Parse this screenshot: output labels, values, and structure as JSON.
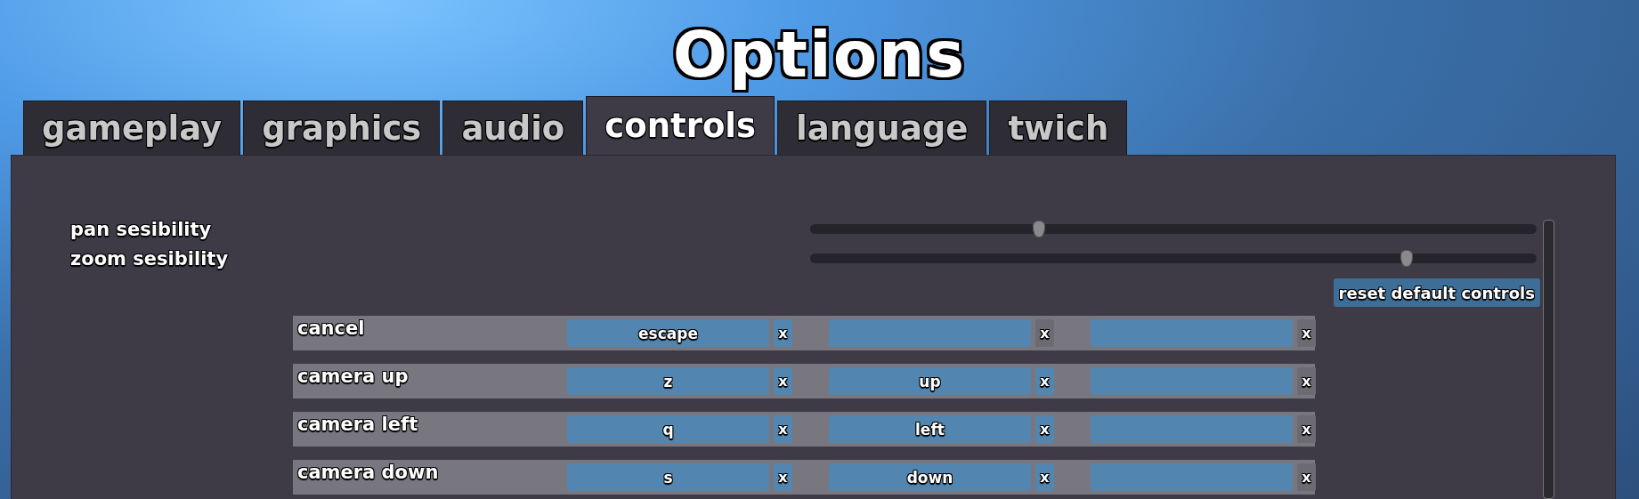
{
  "title": "Options",
  "tabs": [
    {
      "label": "gameplay",
      "selected": false
    },
    {
      "label": "graphics",
      "selected": false
    },
    {
      "label": "audio",
      "selected": false
    },
    {
      "label": "controls",
      "selected": true
    },
    {
      "label": "language",
      "selected": false
    },
    {
      "label": "twich",
      "selected": false
    }
  ],
  "sliders": [
    {
      "label": "pan sesibility",
      "level": 0.314
    },
    {
      "label": "zoom sesibility",
      "level": 0.82
    }
  ],
  "reset_button": "reset default controls",
  "bindings": [
    {
      "action": "cancel",
      "keys": [
        {
          "key": "escape",
          "clear": "x",
          "bound": true
        },
        {
          "clear": "x",
          "bound": false
        },
        {
          "clear": "x",
          "bound": false
        }
      ]
    },
    {
      "action": "camera up",
      "keys": [
        {
          "key": "z",
          "clear": "x",
          "bound": true
        },
        {
          "key": "up",
          "clear": "x",
          "bound": true
        },
        {
          "clear": "x",
          "bound": false
        }
      ]
    },
    {
      "action": "camera left",
      "keys": [
        {
          "key": "q",
          "clear": "x",
          "bound": true
        },
        {
          "key": "left",
          "clear": "x",
          "bound": true
        },
        {
          "clear": "x",
          "bound": false
        }
      ]
    },
    {
      "action": "camera down",
      "keys": [
        {
          "key": "s",
          "clear": "x",
          "bound": true
        },
        {
          "key": "down",
          "clear": "x",
          "bound": true
        },
        {
          "clear": "x",
          "bound": false
        }
      ]
    }
  ]
}
